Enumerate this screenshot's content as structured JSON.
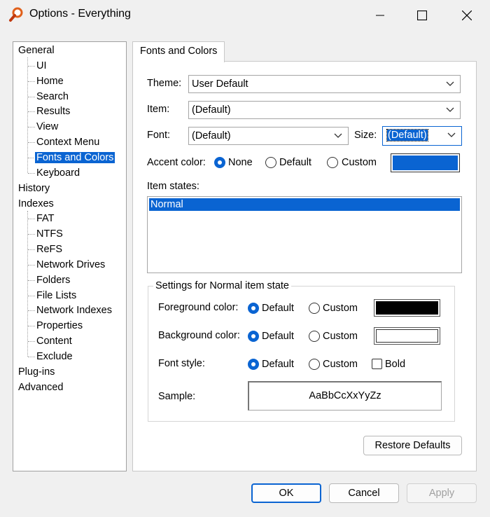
{
  "window": {
    "title": "Options - Everything"
  },
  "tree": {
    "items": [
      {
        "label": "General",
        "level": 0
      },
      {
        "label": "UI",
        "level": 1
      },
      {
        "label": "Home",
        "level": 1
      },
      {
        "label": "Search",
        "level": 1
      },
      {
        "label": "Results",
        "level": 1
      },
      {
        "label": "View",
        "level": 1
      },
      {
        "label": "Context Menu",
        "level": 1
      },
      {
        "label": "Fonts and Colors",
        "level": 1,
        "selected": true
      },
      {
        "label": "Keyboard",
        "level": 1
      },
      {
        "label": "History",
        "level": 0
      },
      {
        "label": "Indexes",
        "level": 0
      },
      {
        "label": "FAT",
        "level": 1
      },
      {
        "label": "NTFS",
        "level": 1
      },
      {
        "label": "ReFS",
        "level": 1
      },
      {
        "label": "Network Drives",
        "level": 1
      },
      {
        "label": "Folders",
        "level": 1
      },
      {
        "label": "File Lists",
        "level": 1
      },
      {
        "label": "Network Indexes",
        "level": 1
      },
      {
        "label": "Properties",
        "level": 1
      },
      {
        "label": "Content",
        "level": 1
      },
      {
        "label": "Exclude",
        "level": 1
      },
      {
        "label": "Plug-ins",
        "level": 0
      },
      {
        "label": "Advanced",
        "level": 0
      }
    ]
  },
  "tab": {
    "label": "Fonts and Colors"
  },
  "form": {
    "theme_label": "Theme:",
    "theme_value": "User Default",
    "item_label": "Item:",
    "item_value": "(Default)",
    "font_label": "Font:",
    "font_value": "(Default)",
    "size_label": "Size:",
    "size_value": "(Default)",
    "accent_label": "Accent color:",
    "accent_none": "None",
    "accent_default": "Default",
    "accent_custom": "Custom",
    "accent_selected": "None",
    "accent_color": "#0a64d2",
    "item_states_label": "Item states:",
    "item_states": [
      "Normal"
    ],
    "item_states_selected": "Normal"
  },
  "settings": {
    "group_title": "Settings for Normal item state",
    "fg_label": "Foreground color:",
    "fg_default": "Default",
    "fg_custom": "Custom",
    "fg_color": "#000000",
    "bg_label": "Background color:",
    "bg_default": "Default",
    "bg_custom": "Custom",
    "bg_color": "#ffffff",
    "style_label": "Font style:",
    "style_default": "Default",
    "style_custom": "Custom",
    "style_bold": "Bold",
    "sample_label": "Sample:",
    "sample_text": "AaBbCcXxYyZz"
  },
  "buttons": {
    "restore": "Restore Defaults",
    "ok": "OK",
    "cancel": "Cancel",
    "apply": "Apply"
  }
}
